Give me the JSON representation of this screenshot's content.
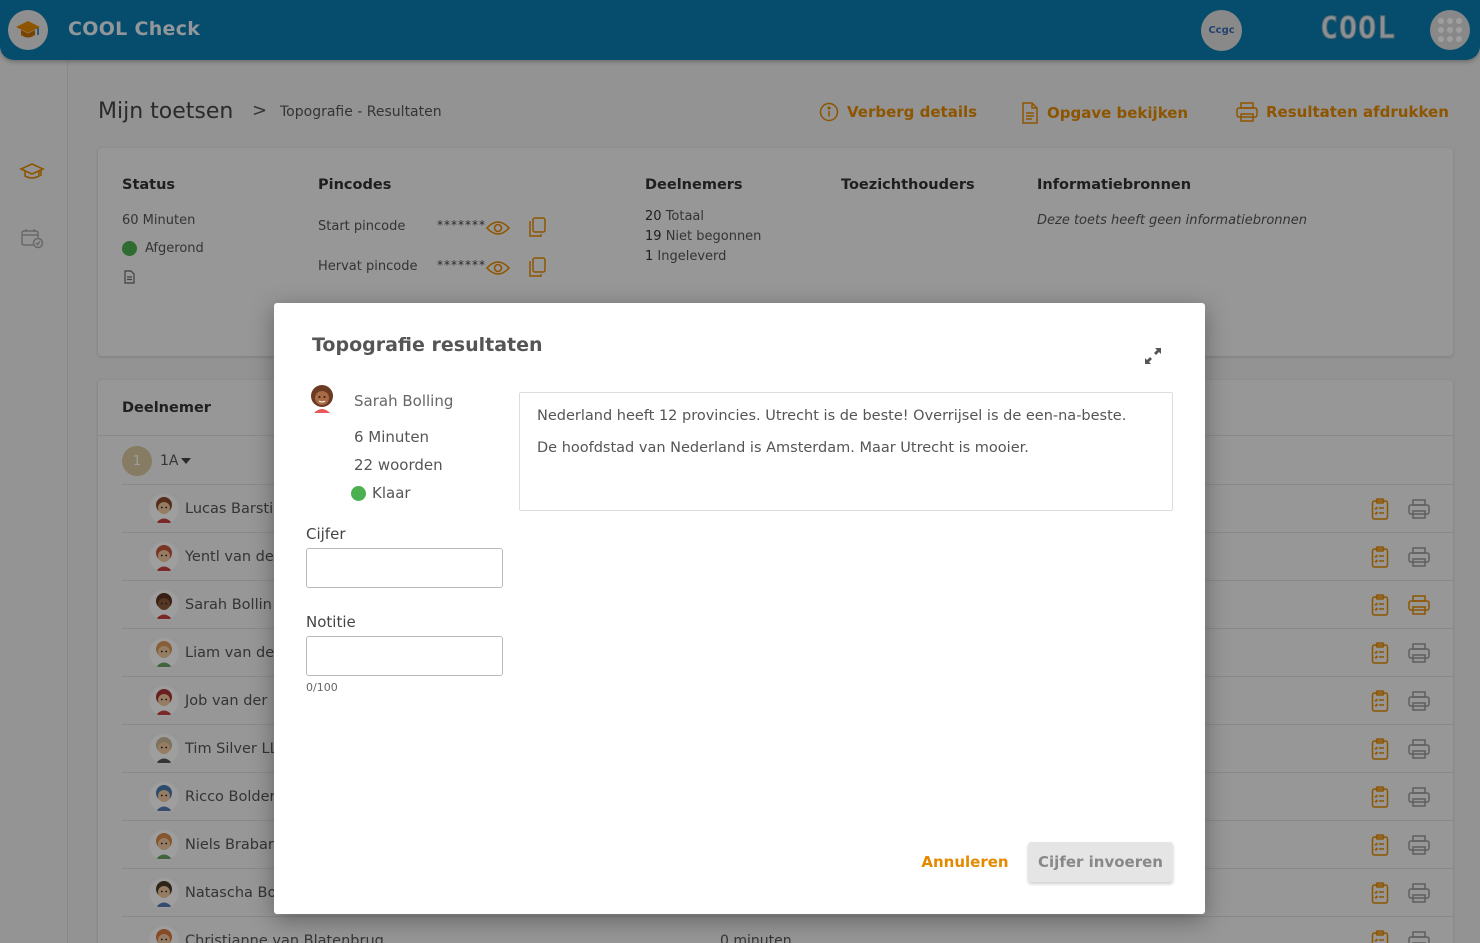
{
  "topbar": {
    "app_title": "COOL Check",
    "school_logo_text": "Ccgc",
    "brand": "COOL",
    "logo_icon": "graduation-cap-icon",
    "apps_icon": "apps-grid-icon"
  },
  "rail": {
    "items": [
      {
        "icon": "graduation-cap-icon"
      },
      {
        "icon": "calendar-check-icon"
      }
    ]
  },
  "header": {
    "title": "Mijn toetsen",
    "separator": ">",
    "breadcrumb": "Topografie  - Resultaten",
    "actions": {
      "hide_details": "Verberg details",
      "view_assignment": "Opgave bekijken",
      "print_results": "Resultaten afdrukken"
    }
  },
  "info": {
    "status": {
      "title": "Status",
      "duration": "60 Minuten",
      "state": "Afgerond"
    },
    "pincodes": {
      "title": "Pincodes",
      "start_label": "Start pincode",
      "start_value": "*******",
      "resume_label": "Hervat pincode",
      "resume_value": "*******"
    },
    "participants": {
      "title": "Deelnemers",
      "total_num": "20",
      "total_label": "Totaal",
      "not_started_num": "19",
      "not_started_label": "Niet begonnen",
      "submitted_num": "1",
      "submitted_label": "Ingeleverd"
    },
    "supervisors": {
      "title": "Toezichthouders"
    },
    "sources": {
      "title": "Informatiebronnen",
      "empty_text": "Deze toets heeft geen informatiebronnen"
    }
  },
  "list": {
    "title": "Deelnemer",
    "group": {
      "badge": "1",
      "name": "1A"
    },
    "rows": [
      {
        "name": "Lucas Barsti",
        "meta": ""
      },
      {
        "name": "Yentl van de",
        "meta": ""
      },
      {
        "name": "Sarah Bollin",
        "meta": ""
      },
      {
        "name": "Liam van de",
        "meta": ""
      },
      {
        "name": "Job van der",
        "meta": ""
      },
      {
        "name": "Tim Silver LL",
        "meta": ""
      },
      {
        "name": "Ricco Bolder",
        "meta": ""
      },
      {
        "name": "Niels Brabar",
        "meta": ""
      },
      {
        "name": "Natascha Bo",
        "meta": ""
      },
      {
        "name": "Christianne van Blatenbrug",
        "meta": "0 minuten"
      }
    ]
  },
  "modal": {
    "title": "Topografie resultaten",
    "student": {
      "name": "Sarah Bolling",
      "minutes": "6 Minuten",
      "words": "22 woorden",
      "status": "Klaar"
    },
    "answer": {
      "line1": "Nederland heeft 12 provincies. Utrecht is de beste! Overrijsel is de een-na-beste.",
      "line2": "De hoofdstad van Nederland is Amsterdam. Maar Utrecht is mooier."
    },
    "grade_label": "Cijfer",
    "grade_value": "",
    "note_label": "Notitie",
    "note_value": "",
    "note_counter": "0/100",
    "cancel_label": "Annuleren",
    "submit_label": "Cijfer invoeren"
  },
  "colors": {
    "topbar": "#0a7bb0",
    "accent": "#e58a00",
    "status_green": "#4caf50",
    "background": "#ededed"
  }
}
